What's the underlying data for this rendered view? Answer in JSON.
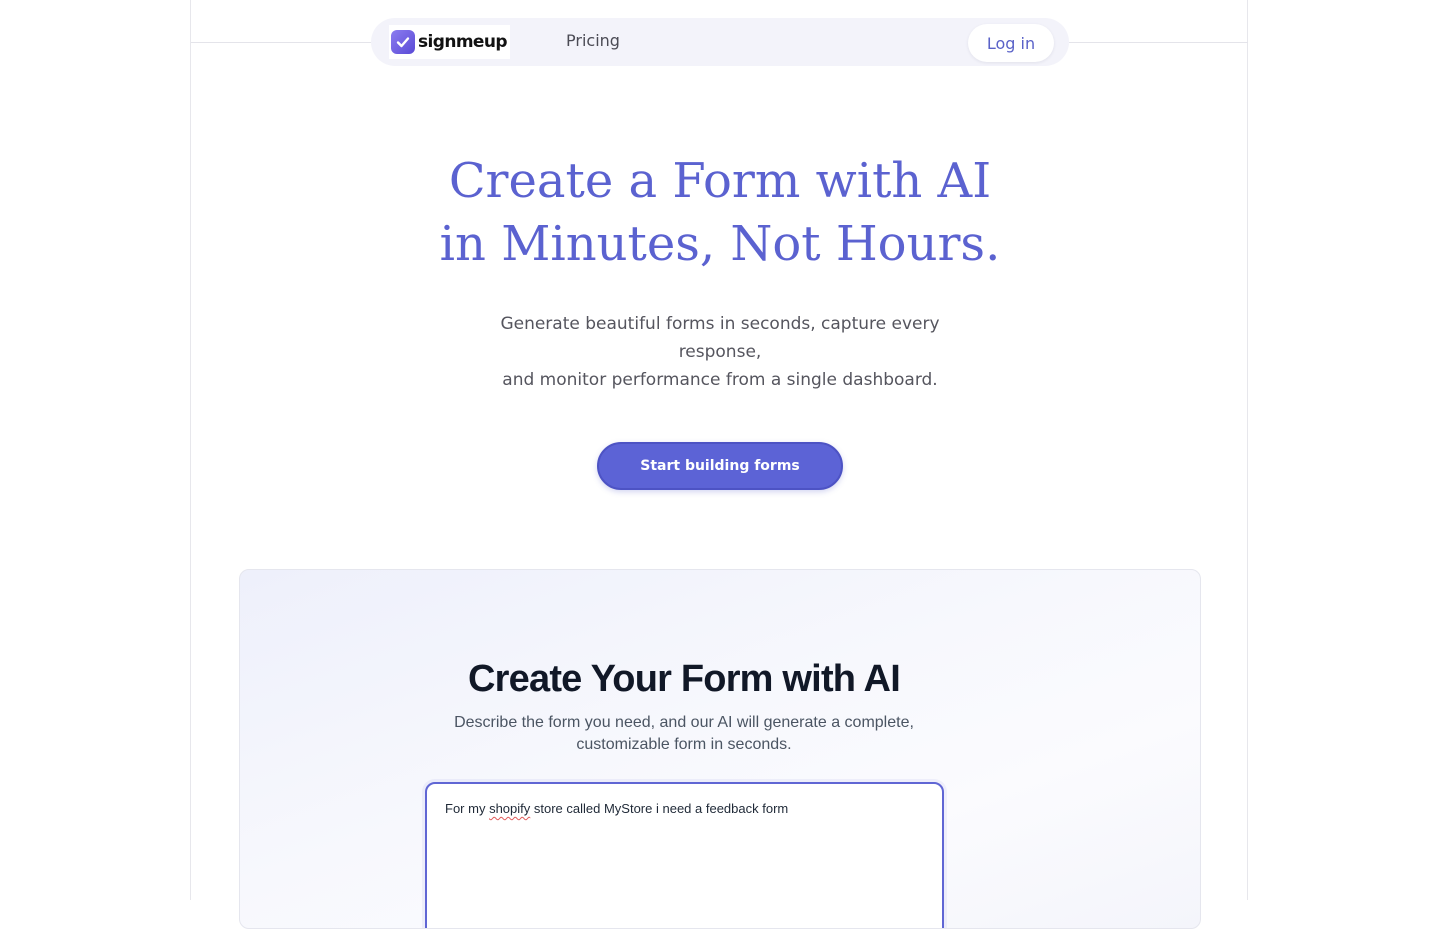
{
  "nav": {
    "logo_text": "signmeup",
    "pricing_label": "Pricing",
    "login_label": "Log in"
  },
  "hero": {
    "title_line1": "Create a Form with AI",
    "title_line2": "in Minutes, Not Hours.",
    "subtitle_line1": "Generate beautiful forms in seconds, capture every",
    "subtitle_line2": "response,",
    "subtitle_line3": "and monitor performance from a single dashboard.",
    "cta_label": "Start building forms"
  },
  "ai_builder": {
    "title": "Create Your Form with AI",
    "description_line1": "Describe the form you need, and our AI will generate a complete,",
    "description_line2": "customizable form in seconds.",
    "prompt_before": "For my ",
    "prompt_misspelled": "shopify",
    "prompt_after": " store called MyStore i need a feedback form"
  },
  "colors": {
    "brand": "#5b62d0",
    "cta_bg": "#5c63d6",
    "logo_gradient_start": "#8b7cf0",
    "logo_gradient_end": "#5a4ad6"
  },
  "icons": {
    "logo": "checkmark-badge-icon"
  }
}
